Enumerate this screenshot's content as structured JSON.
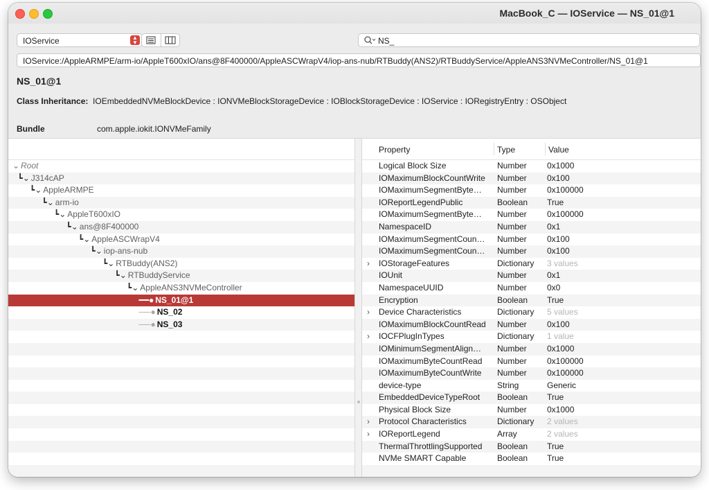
{
  "window": {
    "title": "MacBook_C — IOService — NS_01@1"
  },
  "toolbar": {
    "plane_select": "IOService",
    "search_value": "NS_"
  },
  "path": "IOService:/AppleARMPE/arm-io/AppleT600xIO/ans@8F400000/AppleASCWrapV4/iop-ans-nub/RTBuddy(ANS2)/RTBuddyService/AppleANS3NVMeController/NS_01@1",
  "object": {
    "name": "NS_01@1",
    "inheritance_label": "Class Inheritance:",
    "inheritance": "IOEmbeddedNVMeBlockDevice : IONVMeBlockStorageDevice : IOBlockStorageDevice : IOService : IORegistryEntry : OSObject",
    "bundle_label": "Bundle",
    "bundle": "com.apple.iokit.IONVMeFamily"
  },
  "tree": [
    {
      "label": "Root",
      "level": 0,
      "kind": "root"
    },
    {
      "label": "J314cAP",
      "level": 1,
      "kind": "node"
    },
    {
      "label": "AppleARMPE",
      "level": 2,
      "kind": "node"
    },
    {
      "label": "arm-io",
      "level": 3,
      "kind": "node"
    },
    {
      "label": "AppleT600xIO",
      "level": 4,
      "kind": "node"
    },
    {
      "label": "ans@8F400000",
      "level": 5,
      "kind": "node"
    },
    {
      "label": "AppleASCWrapV4",
      "level": 6,
      "kind": "node"
    },
    {
      "label": "iop-ans-nub",
      "level": 7,
      "kind": "node"
    },
    {
      "label": "RTBuddy(ANS2)",
      "level": 8,
      "kind": "node"
    },
    {
      "label": "RTBuddyService",
      "level": 9,
      "kind": "node"
    },
    {
      "label": "AppleANS3NVMeController",
      "level": 10,
      "kind": "node"
    },
    {
      "label": "NS_01@1",
      "level": 11,
      "kind": "leaf",
      "selected": true
    },
    {
      "label": "NS_02",
      "level": 11,
      "kind": "leaf"
    },
    {
      "label": "NS_03",
      "level": 11,
      "kind": "leaf"
    }
  ],
  "tree_blank_rows": 12,
  "properties": {
    "headers": {
      "property": "Property",
      "type": "Type",
      "value": "Value"
    },
    "rows": [
      {
        "name": "Logical Block Size",
        "type": "Number",
        "value": "0x1000"
      },
      {
        "name": "IOMaximumBlockCountWrite",
        "type": "Number",
        "value": "0x100"
      },
      {
        "name": "IOMaximumSegmentByte…",
        "type": "Number",
        "value": "0x100000"
      },
      {
        "name": "IOReportLegendPublic",
        "type": "Boolean",
        "value": "True"
      },
      {
        "name": "IOMaximumSegmentByte…",
        "type": "Number",
        "value": "0x100000"
      },
      {
        "name": "NamespaceID",
        "type": "Number",
        "value": "0x1"
      },
      {
        "name": "IOMaximumSegmentCoun…",
        "type": "Number",
        "value": "0x100"
      },
      {
        "name": "IOMaximumSegmentCoun…",
        "type": "Number",
        "value": "0x100"
      },
      {
        "name": "IOStorageFeatures",
        "type": "Dictionary",
        "value": "3 values",
        "expandable": true
      },
      {
        "name": "IOUnit",
        "type": "Number",
        "value": "0x1"
      },
      {
        "name": "NamespaceUUID",
        "type": "Number",
        "value": "0x0"
      },
      {
        "name": "Encryption",
        "type": "Boolean",
        "value": "True"
      },
      {
        "name": "Device Characteristics",
        "type": "Dictionary",
        "value": "5 values",
        "expandable": true
      },
      {
        "name": "IOMaximumBlockCountRead",
        "type": "Number",
        "value": "0x100"
      },
      {
        "name": "IOCFPlugInTypes",
        "type": "Dictionary",
        "value": "1 value",
        "expandable": true
      },
      {
        "name": "IOMinimumSegmentAlign…",
        "type": "Number",
        "value": "0x1000"
      },
      {
        "name": "IOMaximumByteCountRead",
        "type": "Number",
        "value": "0x100000"
      },
      {
        "name": "IOMaximumByteCountWrite",
        "type": "Number",
        "value": "0x100000"
      },
      {
        "name": "device-type",
        "type": "String",
        "value": "Generic"
      },
      {
        "name": "EmbeddedDeviceTypeRoot",
        "type": "Boolean",
        "value": "True"
      },
      {
        "name": "Physical Block Size",
        "type": "Number",
        "value": "0x1000"
      },
      {
        "name": "Protocol Characteristics",
        "type": "Dictionary",
        "value": "2 values",
        "expandable": true
      },
      {
        "name": "IOReportLegend",
        "type": "Array",
        "value": "2 values",
        "expandable": true
      },
      {
        "name": "ThermalThrottlingSupported",
        "type": "Boolean",
        "value": "True"
      },
      {
        "name": "NVMe SMART Capable",
        "type": "Boolean",
        "value": "True"
      }
    ]
  },
  "props_blank_rows": 1,
  "colors": {
    "selection": "#b83a37",
    "close": "#fe5f57",
    "minimize": "#febc2e",
    "zoom": "#28c840"
  }
}
